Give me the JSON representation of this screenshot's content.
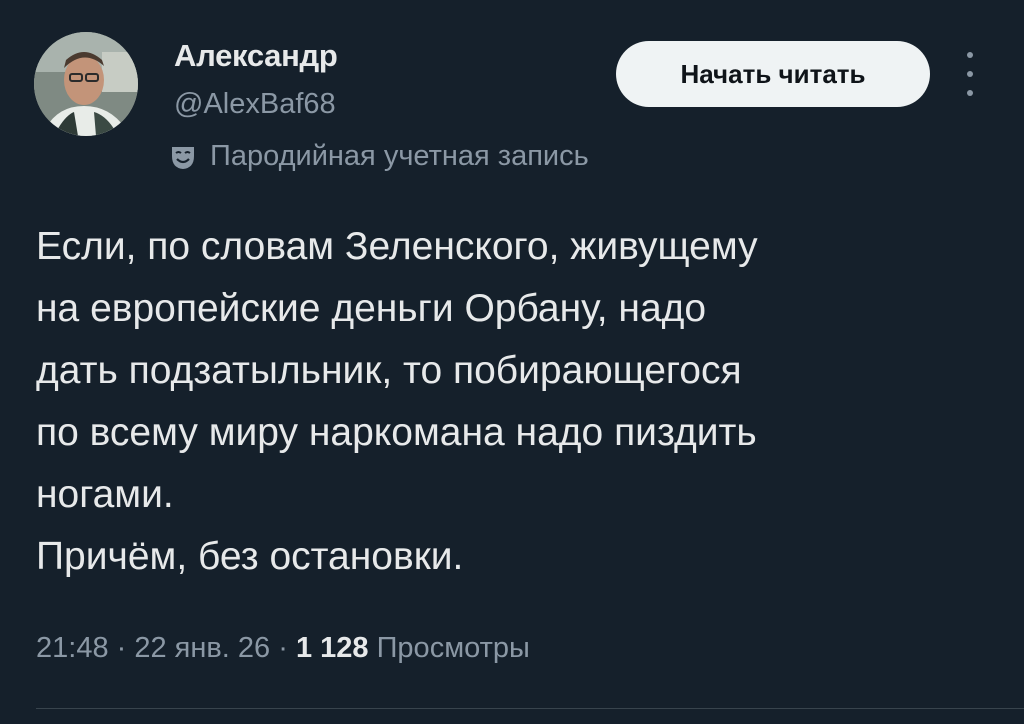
{
  "author": {
    "name": "Александр",
    "handle": "@AlexBaf68",
    "label": "Пародийная учетная запись"
  },
  "follow_button": "Начать читать",
  "body_lines": [
    "Если, по словам Зеленского, живущему",
    "на европейские деньги Орбану, надо",
    "дать подзатыльник, то побирающегося",
    "по всему миру наркомана надо пиздить",
    "ногами.",
    "Причём, без остановки."
  ],
  "meta": {
    "time": "21:48",
    "sep1": " · ",
    "date": "22 янв. 26",
    "sep2": " · ",
    "views_count": "1 128",
    "views_label": " Просмотры"
  },
  "colors": {
    "background": "#15202b",
    "text": "#e7e9ea",
    "secondary": "#8b98a5",
    "button_bg": "#eff3f4"
  }
}
